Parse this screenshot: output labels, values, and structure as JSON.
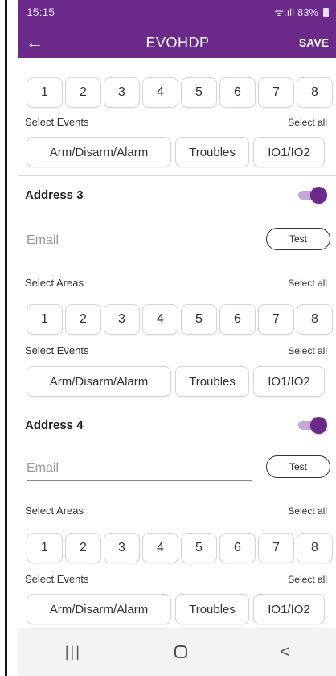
{
  "status_bar": {
    "time": "15:15",
    "signal": "ᯤ.ıll",
    "battery": "83%"
  },
  "app_bar": {
    "title": "EVOHDP",
    "save_label": "SAVE"
  },
  "top_section": {
    "areas": [
      "1",
      "2",
      "3",
      "4",
      "5",
      "6",
      "7",
      "8"
    ],
    "select_events_label": "Select Events",
    "select_all_label": "Select all",
    "events": [
      "Arm/Disarm/Alarm",
      "Troubles",
      "IO1/IO2"
    ]
  },
  "addresses": [
    {
      "title": "Address 3",
      "enabled": true,
      "email_placeholder": "Email",
      "email_value": "",
      "test_label": "Test",
      "select_areas_label": "Select Areas",
      "select_all_areas_label": "Select all",
      "areas": [
        "1",
        "2",
        "3",
        "4",
        "5",
        "6",
        "7",
        "8"
      ],
      "select_events_label": "Select Events",
      "select_all_events_label": "Select all",
      "events": [
        "Arm/Disarm/Alarm",
        "Troubles",
        "IO1/IO2"
      ]
    },
    {
      "title": "Address 4",
      "enabled": true,
      "email_placeholder": "Email",
      "email_value": "",
      "test_label": "Test",
      "select_areas_label": "Select Areas",
      "select_all_areas_label": "Select all",
      "areas": [
        "1",
        "2",
        "3",
        "4",
        "5",
        "6",
        "7",
        "8"
      ],
      "select_events_label": "Select Events",
      "select_all_events_label": "Select all",
      "events": [
        "Arm/Disarm/Alarm",
        "Troubles",
        "IO1/IO2"
      ]
    }
  ],
  "nav_bar": {
    "recents_glyph": "|||",
    "back_glyph": "<"
  },
  "colors": {
    "accent": "#6b2a8a",
    "toggle_track": "#c9a6d8"
  },
  "icons": {
    "back": "arrow-left-icon",
    "wifi": "wifi-icon",
    "battery": "battery-icon",
    "home": "home-icon"
  }
}
